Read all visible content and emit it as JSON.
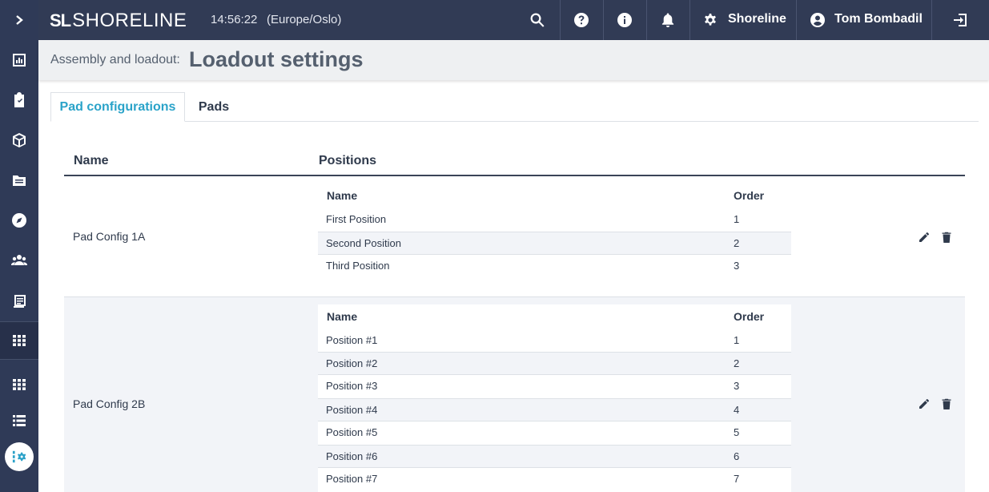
{
  "app": {
    "logo_mark": "SL",
    "logo_text": "SHORELINE",
    "time": "14:56:22",
    "timezone": "(Europe/Oslo)",
    "org_label": "Shoreline",
    "user_label": "Tom Bombadil"
  },
  "header": {
    "breadcrumb": "Assembly and loadout:",
    "title": "Loadout settings"
  },
  "tabs": [
    {
      "label": "Pad configurations",
      "active": true
    },
    {
      "label": "Pads",
      "active": false
    }
  ],
  "table": {
    "col_name": "Name",
    "col_positions": "Positions",
    "inner_col_name": "Name",
    "inner_col_order": "Order",
    "rows": [
      {
        "name": "Pad Config 1A",
        "positions": [
          {
            "name": "First Position",
            "order": "1"
          },
          {
            "name": "Second Position",
            "order": "2"
          },
          {
            "name": "Third Position",
            "order": "3"
          }
        ]
      },
      {
        "name": "Pad Config 2B",
        "positions": [
          {
            "name": "Position #1",
            "order": "1"
          },
          {
            "name": "Position #2",
            "order": "2"
          },
          {
            "name": "Position #3",
            "order": "3"
          },
          {
            "name": "Position #4",
            "order": "4"
          },
          {
            "name": "Position #5",
            "order": "5"
          },
          {
            "name": "Position #6",
            "order": "6"
          },
          {
            "name": "Position #7",
            "order": "7"
          }
        ]
      }
    ]
  },
  "colors": {
    "sidebar": "#2f3a57",
    "topbar": "#313b55",
    "accent": "#2aa3c9",
    "row_alt": "#f2f4f8"
  },
  "icons": {
    "sidebar": [
      "chevron-right-icon",
      "chart-icon",
      "clipboard-check-icon",
      "box-icon",
      "file-icon",
      "compass-icon",
      "users-icon",
      "calendar-list-icon",
      "grid-icon",
      "grid-icon",
      "list-icon",
      "settings-icon"
    ],
    "topbar": [
      "search-icon",
      "help-icon",
      "info-icon",
      "bell-icon",
      "gear-icon",
      "user-circle-icon",
      "logout-icon"
    ],
    "row_actions": [
      "edit-icon",
      "delete-icon"
    ]
  }
}
